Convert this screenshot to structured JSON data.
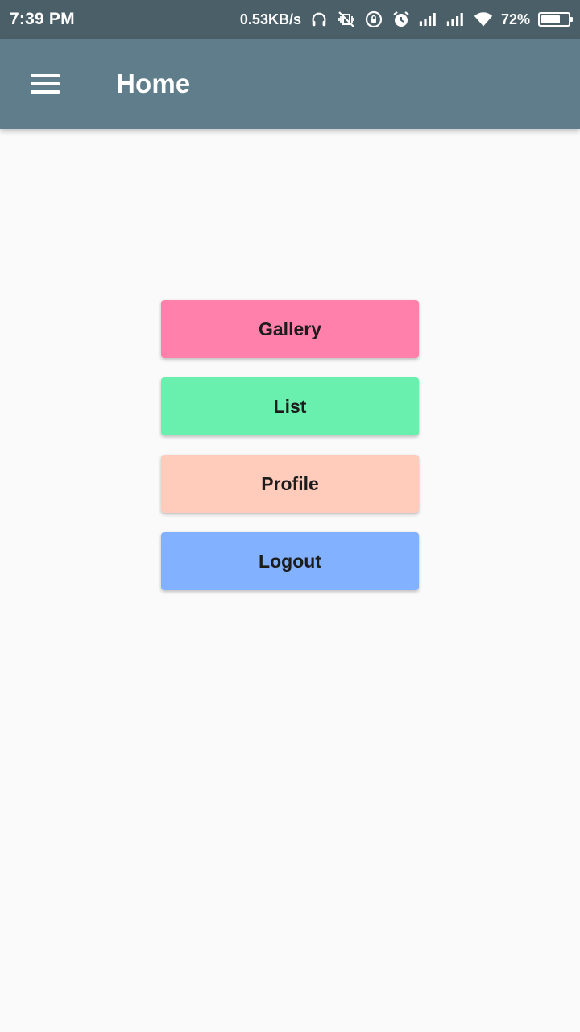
{
  "status_bar": {
    "time": "7:39 PM",
    "net_speed": "0.53KB/s",
    "battery_percent_text": "72%",
    "battery_level": 0.72,
    "icons": [
      "headset-icon",
      "vibrate-off-icon",
      "rotation-lock-icon",
      "alarm-icon",
      "signal-icon",
      "signal-icon",
      "wifi-icon",
      "battery-icon"
    ]
  },
  "app_bar": {
    "title": "Home",
    "menu_icon": "hamburger-menu-icon"
  },
  "buttons": [
    {
      "label": "Gallery",
      "color": "#ff80ab"
    },
    {
      "label": "List",
      "color": "#69f0ae"
    },
    {
      "label": "Profile",
      "color": "#ffccbc"
    },
    {
      "label": "Logout",
      "color": "#82b1ff"
    }
  ],
  "colors": {
    "status_bar": "#4b5f69",
    "app_bar": "#607d8b",
    "background": "#fafafa"
  }
}
